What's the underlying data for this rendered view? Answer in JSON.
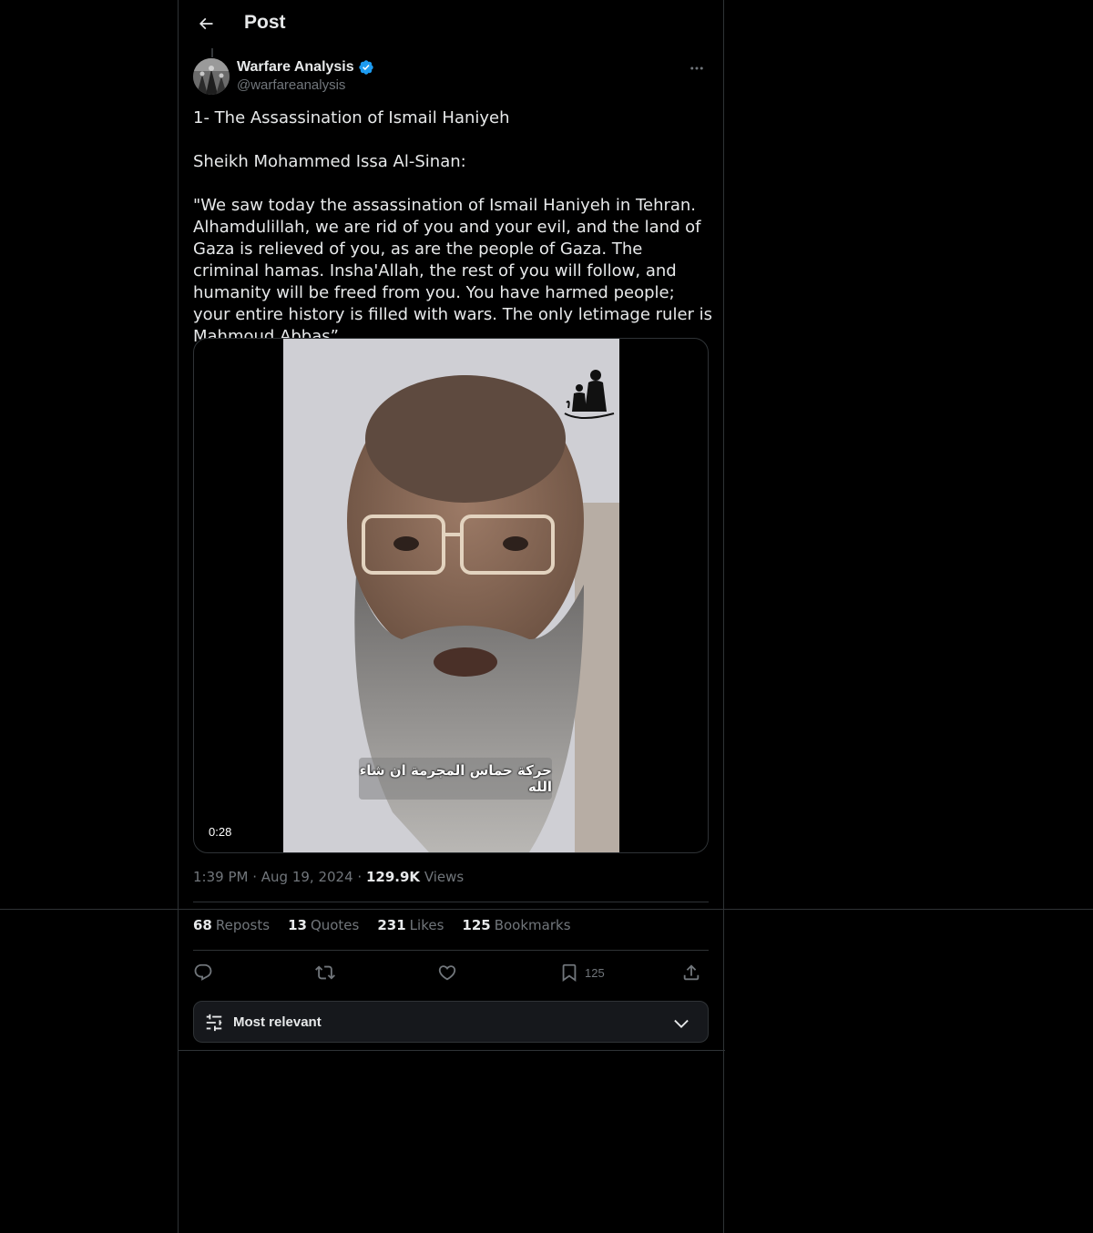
{
  "header": {
    "title": "Post"
  },
  "author": {
    "display_name": "Warfare Analysis",
    "handle": "@warfareanalysis",
    "verified": true
  },
  "tweet": {
    "paragraphs": [
      "1- The Assassination of Ismail Haniyeh",
      "Sheikh Mohammed Issa Al-Sinan:",
      "\"We saw today the assassination of Ismail Haniyeh in Tehran. Alhamdulillah, we are rid of you and your evil, and the land of Gaza is relieved of you, as are the people of Gaza. The criminal hamas. Insha'Allah, the rest of you will follow, and humanity will be freed from you. You have harmed people; your entire history is filled with wars. The only letimage ruler is Mahmoud Abbas”"
    ]
  },
  "media": {
    "type": "video",
    "duration": "0:28",
    "caption": "حركة حماس المجرمة ان شاء الله"
  },
  "meta": {
    "time": "1:39 PM",
    "date": "Aug 19, 2024",
    "views_count": "129.9K",
    "views_label": "Views"
  },
  "stats": {
    "reposts_count": "68",
    "reposts_label": "Reposts",
    "quotes_count": "13",
    "quotes_label": "Quotes",
    "likes_count": "231",
    "likes_label": "Likes",
    "bookmarks_count": "125",
    "bookmarks_label": "Bookmarks"
  },
  "actions": {
    "bookmark_count": "125",
    "icons": [
      "reply-icon",
      "repost-icon",
      "like-icon",
      "bookmark-icon",
      "share-icon"
    ]
  },
  "sort": {
    "label": "Most relevant"
  },
  "colors": {
    "background": "#000000",
    "text": "#e7e9ea",
    "muted": "#71767b",
    "border": "#2f3336",
    "verified": "#1d9bf0"
  }
}
